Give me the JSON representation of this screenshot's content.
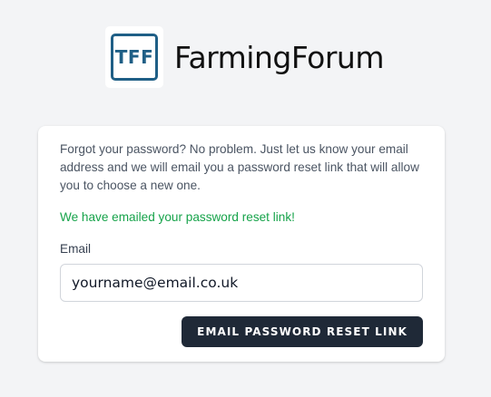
{
  "brand": {
    "logo_mark_text": "TFF",
    "name": "FarmingForum",
    "accent_color": "#1f5f86"
  },
  "form": {
    "intro_text": "Forgot your password? No problem. Just let us know your email address and we will email you a password reset link that will allow you to choose a new one.",
    "status_message": "We have emailed your password reset link!",
    "status_color": "#16a34a",
    "email_label": "Email",
    "email_value": "yourname@email.co.uk",
    "submit_label": "EMAIL PASSWORD RESET LINK"
  }
}
